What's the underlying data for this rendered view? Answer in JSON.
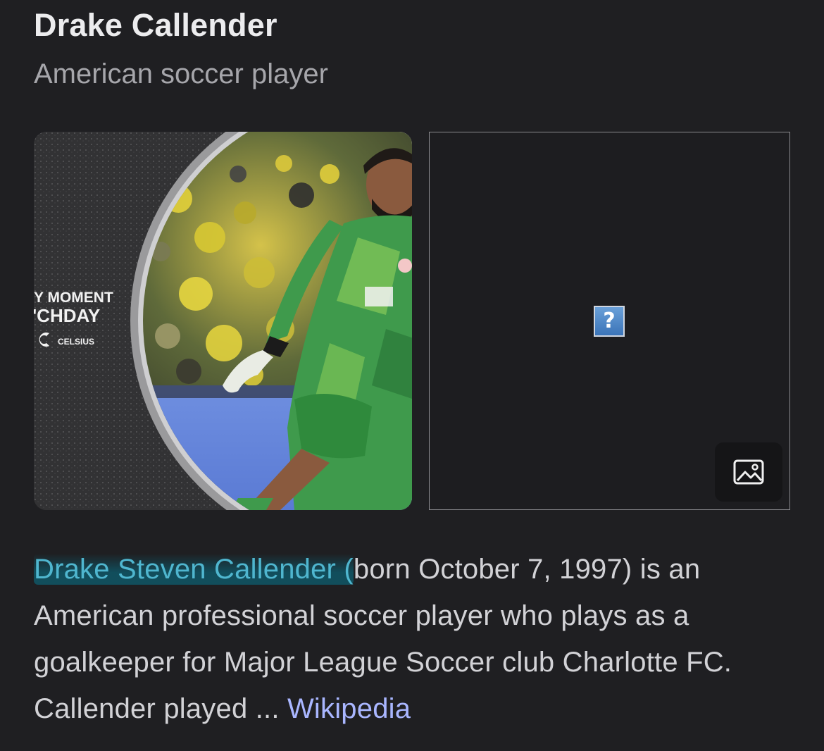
{
  "entity": {
    "title": "Drake Callender",
    "subtitle": "American soccer player"
  },
  "images": {
    "photo_overlay_text": {
      "line1": "Y MOMENT",
      "line2": "'CHDAY",
      "brand": "CELSIUS"
    },
    "broken_image_glyph": "?",
    "image_search_icon": "image-icon"
  },
  "description": {
    "highlighted_name": "Drake Steven Callender (",
    "text": "born October 7, 1997) is an American professional soccer player who plays as a goalkeeper for Major League Soccer club Charlotte FC. Callender played ... ",
    "source_link": "Wikipedia"
  },
  "colors": {
    "background": "#1f1f22",
    "title": "#ececee",
    "subtitle": "#a6a6ab",
    "body_text": "#d2d2d6",
    "highlight_text": "#4fb6cf",
    "highlight_bg": "#0f5666",
    "link": "#a9b6ff",
    "jersey_green": "#3f9a4c"
  }
}
